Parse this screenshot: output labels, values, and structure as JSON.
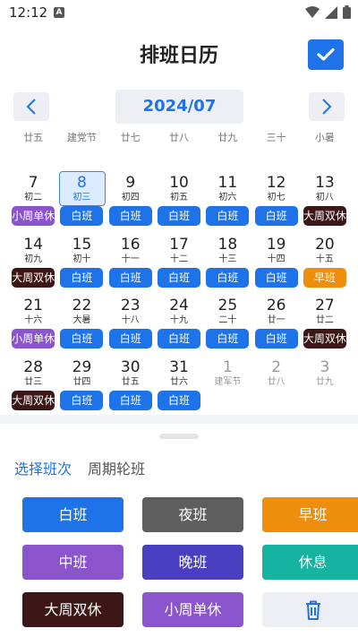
{
  "status": {
    "time": "12:12",
    "a_icon": "A"
  },
  "header": {
    "title": "排班日历",
    "confirm_icon": "check-icon"
  },
  "month": {
    "label": "2024/07"
  },
  "week_header": [
    "廿五",
    "建党节",
    "廿七",
    "廿八",
    "廿九",
    "三十",
    "小暑"
  ],
  "colors": {
    "day": "#1E73E8",
    "night": "#5E5E5E",
    "morning": "#EE8E0C",
    "middle": "#8A55CC",
    "evening": "#4A3FC0",
    "rest": "#15B3A0",
    "big_double": "#3D1717",
    "small_single": "#8A55CC",
    "accent": "#1E73E8"
  },
  "calendar": {
    "weeks": [
      [
        {
          "num": "7",
          "sub": "初二",
          "shift": "小周单休",
          "color": "#8A55CC"
        },
        {
          "num": "8",
          "sub": "初三",
          "shift": "白班",
          "color": "#1E73E8",
          "selected": true
        },
        {
          "num": "9",
          "sub": "初四",
          "shift": "白班",
          "color": "#1E73E8"
        },
        {
          "num": "10",
          "sub": "初五",
          "shift": "白班",
          "color": "#1E73E8"
        },
        {
          "num": "11",
          "sub": "初六",
          "shift": "白班",
          "color": "#1E73E8"
        },
        {
          "num": "12",
          "sub": "初七",
          "shift": "白班",
          "color": "#1E73E8"
        },
        {
          "num": "13",
          "sub": "初八",
          "shift": "大周双休",
          "color": "#3D1717"
        }
      ],
      [
        {
          "num": "14",
          "sub": "初九",
          "shift": "大周双休",
          "color": "#3D1717"
        },
        {
          "num": "15",
          "sub": "初十",
          "shift": "白班",
          "color": "#1E73E8"
        },
        {
          "num": "16",
          "sub": "十一",
          "shift": "白班",
          "color": "#1E73E8"
        },
        {
          "num": "17",
          "sub": "十二",
          "shift": "白班",
          "color": "#1E73E8"
        },
        {
          "num": "18",
          "sub": "十三",
          "shift": "白班",
          "color": "#1E73E8"
        },
        {
          "num": "19",
          "sub": "十四",
          "shift": "白班",
          "color": "#1E73E8"
        },
        {
          "num": "20",
          "sub": "十五",
          "shift": "早班",
          "color": "#EE8E0C"
        }
      ],
      [
        {
          "num": "21",
          "sub": "十六",
          "shift": "小周单休",
          "color": "#8A55CC"
        },
        {
          "num": "22",
          "sub": "大暑",
          "shift": "白班",
          "color": "#1E73E8"
        },
        {
          "num": "23",
          "sub": "十八",
          "shift": "白班",
          "color": "#1E73E8"
        },
        {
          "num": "24",
          "sub": "十九",
          "shift": "白班",
          "color": "#1E73E8"
        },
        {
          "num": "25",
          "sub": "二十",
          "shift": "白班",
          "color": "#1E73E8"
        },
        {
          "num": "26",
          "sub": "廿一",
          "shift": "白班",
          "color": "#1E73E8"
        },
        {
          "num": "27",
          "sub": "廿二",
          "shift": "大周双休",
          "color": "#3D1717"
        }
      ],
      [
        {
          "num": "28",
          "sub": "廿三",
          "shift": "大周双休",
          "color": "#3D1717"
        },
        {
          "num": "29",
          "sub": "廿四",
          "shift": "白班",
          "color": "#1E73E8"
        },
        {
          "num": "30",
          "sub": "廿五",
          "shift": "白班",
          "color": "#1E73E8"
        },
        {
          "num": "31",
          "sub": "廿六",
          "shift": "白班",
          "color": "#1E73E8"
        },
        {
          "num": "1",
          "sub": "建军节",
          "other": true
        },
        {
          "num": "2",
          "sub": "廿八",
          "other": true
        },
        {
          "num": "3",
          "sub": "廿九",
          "other": true
        }
      ]
    ]
  },
  "tabs": [
    {
      "label": "选择班次",
      "active": true
    },
    {
      "label": "周期轮班",
      "active": false
    }
  ],
  "shift_buttons": [
    {
      "label": "白班",
      "color": "#1E73E8"
    },
    {
      "label": "夜班",
      "color": "#5E5E5E"
    },
    {
      "label": "早班",
      "color": "#EE8E0C"
    },
    {
      "label": "中班",
      "color": "#8A55CC"
    },
    {
      "label": "晚班",
      "color": "#4A3FC0"
    },
    {
      "label": "休息",
      "color": "#15B3A0"
    },
    {
      "label": "大周双休",
      "color": "#3D1717"
    },
    {
      "label": "小周单休",
      "color": "#8A55CC"
    },
    {
      "label": "",
      "icon": "trash-icon"
    }
  ]
}
